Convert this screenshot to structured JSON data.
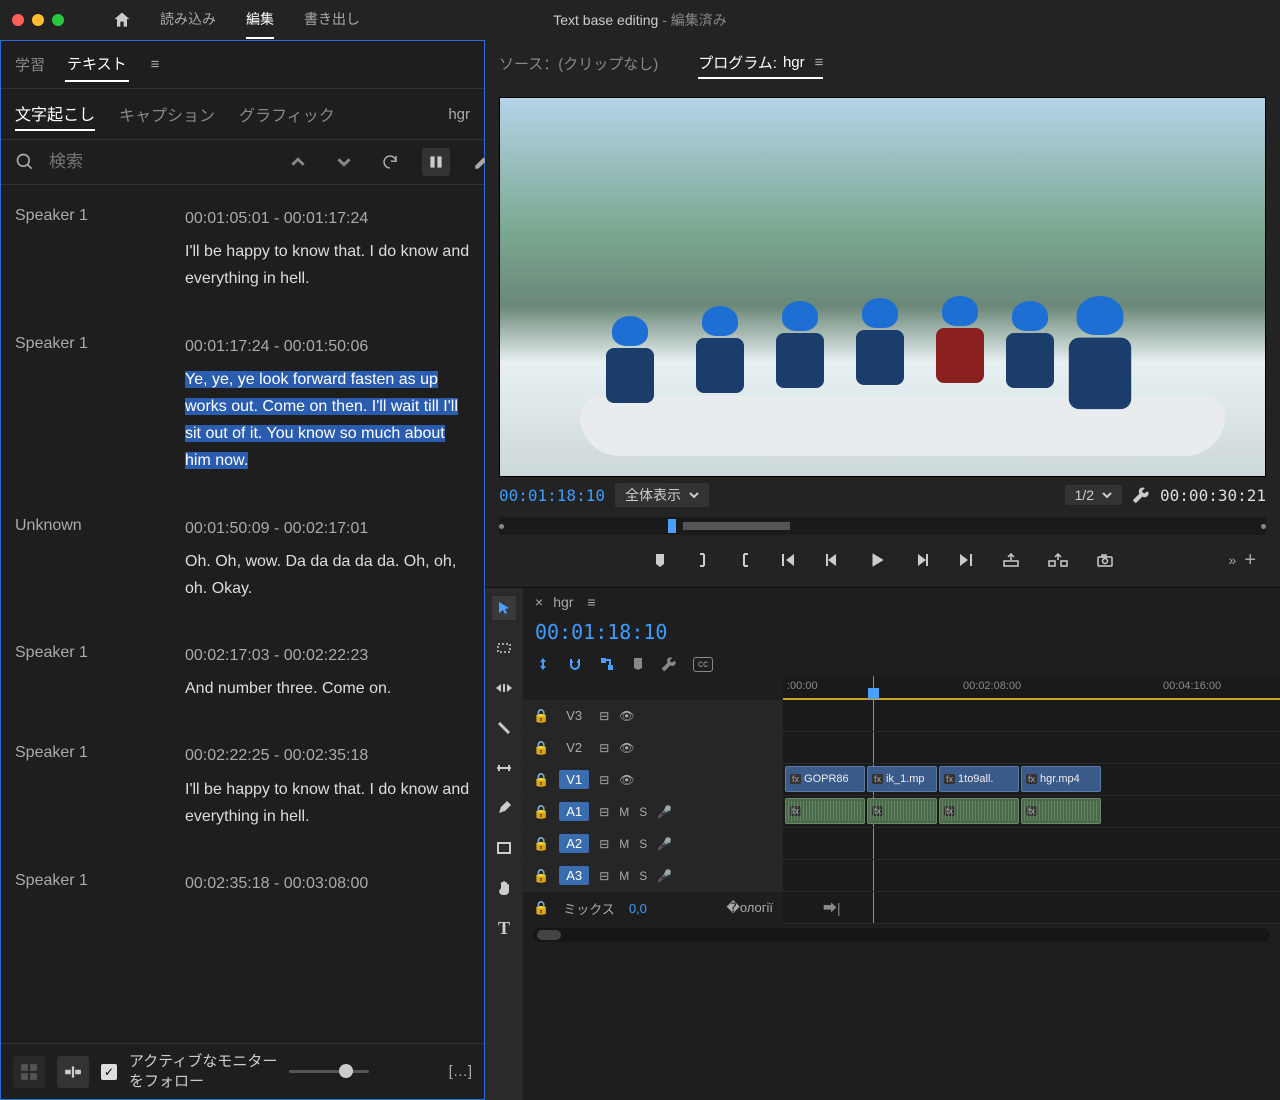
{
  "titlebar": {
    "tabs": [
      "読み込み",
      "編集",
      "書き出し"
    ],
    "active_tab_index": 1,
    "title": "Text base editing",
    "title_suffix": " - 編集済み"
  },
  "left": {
    "panel_tabs": [
      "学習",
      "テキスト"
    ],
    "panel_active": 1,
    "sub_tabs": [
      "文字起こし",
      "キャプション",
      "グラフィック"
    ],
    "sub_active": 0,
    "right_label": "hgr",
    "search_placeholder": "検索",
    "transcript": [
      {
        "speaker": "Speaker 1",
        "tc": "00:01:05:01 - 00:01:17:24",
        "text": "I'll be happy to know that. I do know and everything in hell.",
        "hl": false
      },
      {
        "speaker": "Speaker 1",
        "tc": "00:01:17:24 - 00:01:50:06",
        "text": "Ye, ye, ye look forward fasten as up works out. Come on then. I'll wait till I'll sit out of it. You know so much about him now.",
        "hl": true
      },
      {
        "speaker": "Unknown",
        "tc": "00:01:50:09 - 00:02:17:01",
        "text": "Oh. Oh, wow. Da da da da da. Oh, oh, oh. Okay.",
        "hl": false
      },
      {
        "speaker": "Speaker 1",
        "tc": "00:02:17:03 - 00:02:22:23",
        "text": "And number three. Come on.",
        "hl": false
      },
      {
        "speaker": "Speaker 1",
        "tc": "00:02:22:25 - 00:02:35:18",
        "text": "I'll be happy to know that. I do know and everything in hell.",
        "hl": false
      },
      {
        "speaker": "Speaker 1",
        "tc": "00:02:35:18 - 00:03:08:00",
        "text": "",
        "hl": false
      }
    ],
    "footer_label_line1": "アクティブなモニター",
    "footer_label_line2": "をフォロー",
    "footer_more": "[…]"
  },
  "monitor": {
    "tabs": {
      "source": "ソース：(クリップなし)",
      "program_prefix": "プログラム:",
      "program_name": "hgr"
    },
    "tc_in": "00:01:18:10",
    "fit_label": "全体表示",
    "zoom_label": "1/2",
    "tc_out": "00:00:30:21"
  },
  "timeline": {
    "seq_name": "hgr",
    "tc": "00:01:18:10",
    "ruler_ticks": [
      ":00:00",
      "00:02:08:00",
      "00:04:16:00"
    ],
    "tracks": {
      "v3": "V3",
      "v2": "V2",
      "v1": "V1",
      "a1": "A1",
      "a2": "A2",
      "a3": "A3",
      "mix": "ミックス",
      "mix_val": "0,0",
      "m": "M",
      "s": "S"
    },
    "clips": {
      "v1": [
        "GOPR86",
        "ik_1.mp",
        "1to9all.",
        "hgr.mp4"
      ]
    },
    "fx": "fx"
  }
}
